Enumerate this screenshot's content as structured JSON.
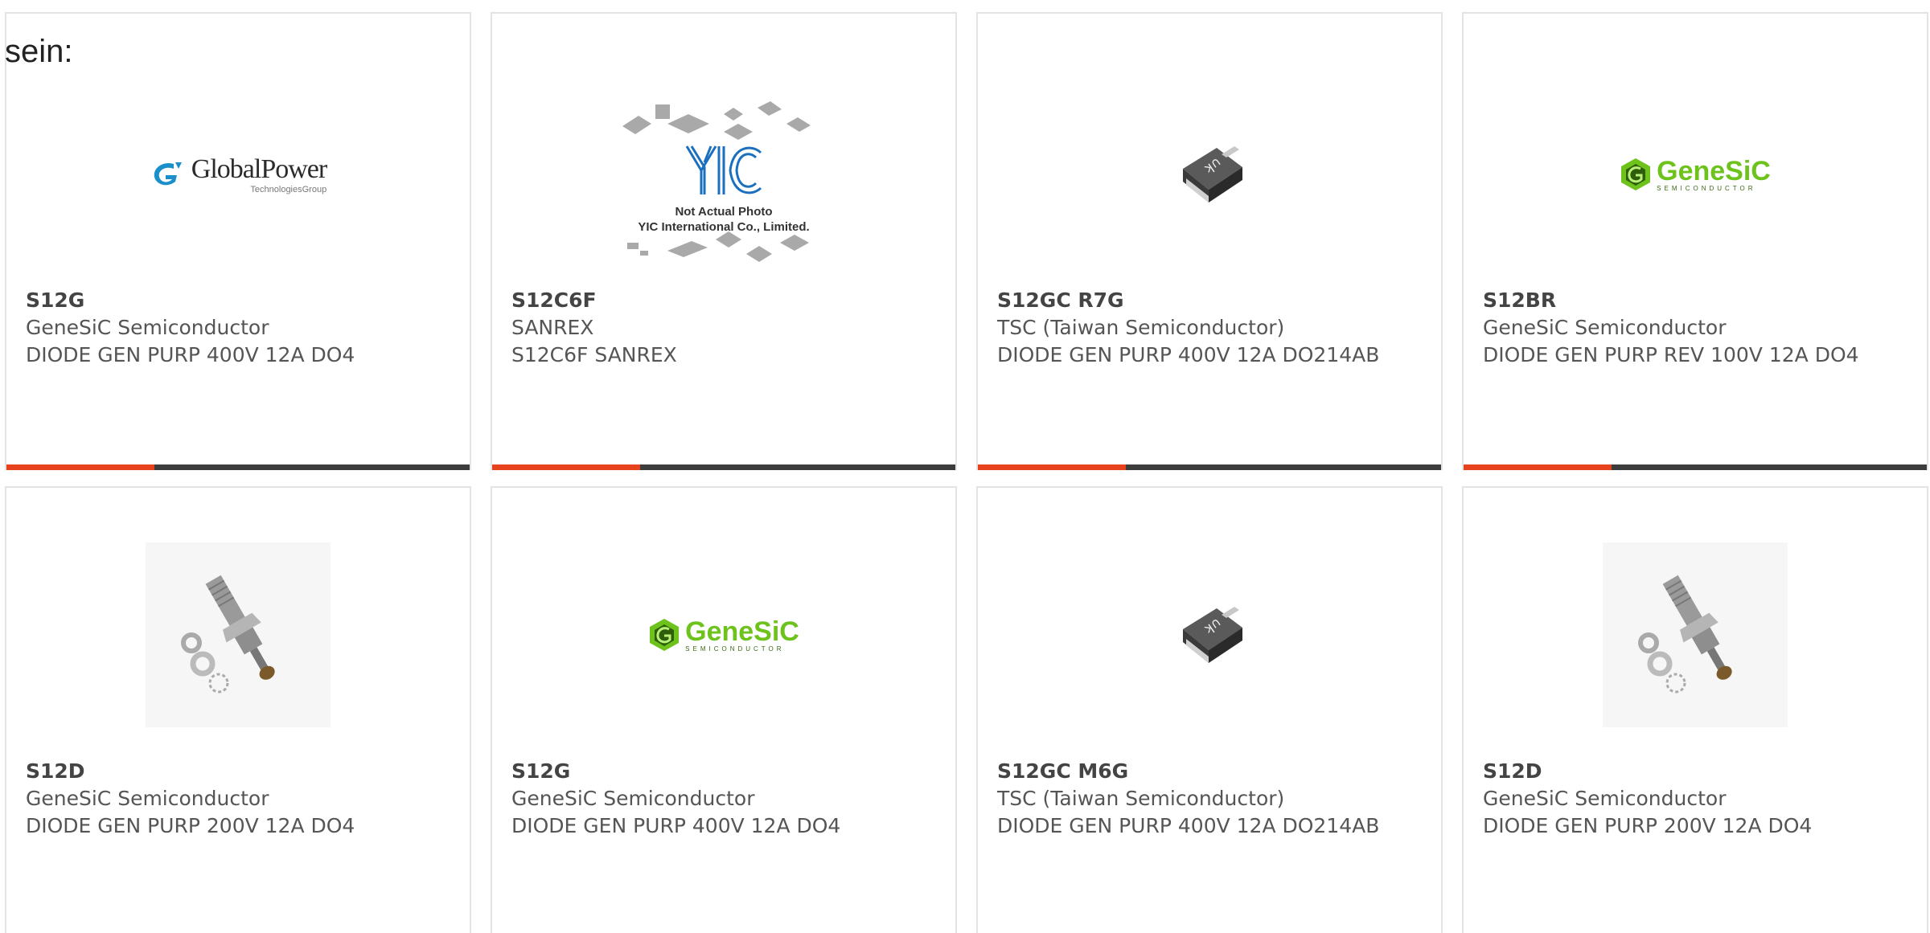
{
  "intro_text": "sein:",
  "colors": {
    "accent": "#e8421c",
    "bar": "#3c3c3c",
    "genesic_green": "#6dc21c",
    "border": "#e3e3e3"
  },
  "logos": {
    "globalpower": {
      "name": "GlobalPower",
      "sub": "TechnologiesGroup"
    },
    "genesic": {
      "name": "GeneSiC",
      "sub": "SEMICONDUCTOR"
    },
    "yic": {
      "line1": "Not Actual Photo",
      "line2": "YIC International Co., Limited."
    }
  },
  "cards": [
    {
      "part": "S12G",
      "maker": "GeneSiC Semiconductor",
      "desc": "DIODE GEN PURP 400V 12A DO4",
      "image": "globalpower-logo"
    },
    {
      "part": "S12C6F",
      "maker": "SANREX",
      "desc": "S12C6F SANREX",
      "image": "yic-placeholder"
    },
    {
      "part": "S12GC R7G",
      "maker": "TSC (Taiwan Semiconductor)",
      "desc": "DIODE GEN PURP 400V 12A DO214AB",
      "image": "smd-diode"
    },
    {
      "part": "S12BR",
      "maker": "GeneSiC Semiconductor",
      "desc": "DIODE GEN PURP REV 100V 12A DO4",
      "image": "genesic-logo"
    },
    {
      "part": "S12D",
      "maker": "GeneSiC Semiconductor",
      "desc": "DIODE GEN PURP 200V 12A DO4",
      "image": "stud-diode"
    },
    {
      "part": "S12G",
      "maker": "GeneSiC Semiconductor",
      "desc": "DIODE GEN PURP 400V 12A DO4",
      "image": "genesic-logo"
    },
    {
      "part": "S12GC M6G",
      "maker": "TSC (Taiwan Semiconductor)",
      "desc": "DIODE GEN PURP 400V 12A DO214AB",
      "image": "smd-diode"
    },
    {
      "part": "S12D",
      "maker": "GeneSiC Semiconductor",
      "desc": "DIODE GEN PURP 200V 12A DO4",
      "image": "stud-diode"
    }
  ]
}
